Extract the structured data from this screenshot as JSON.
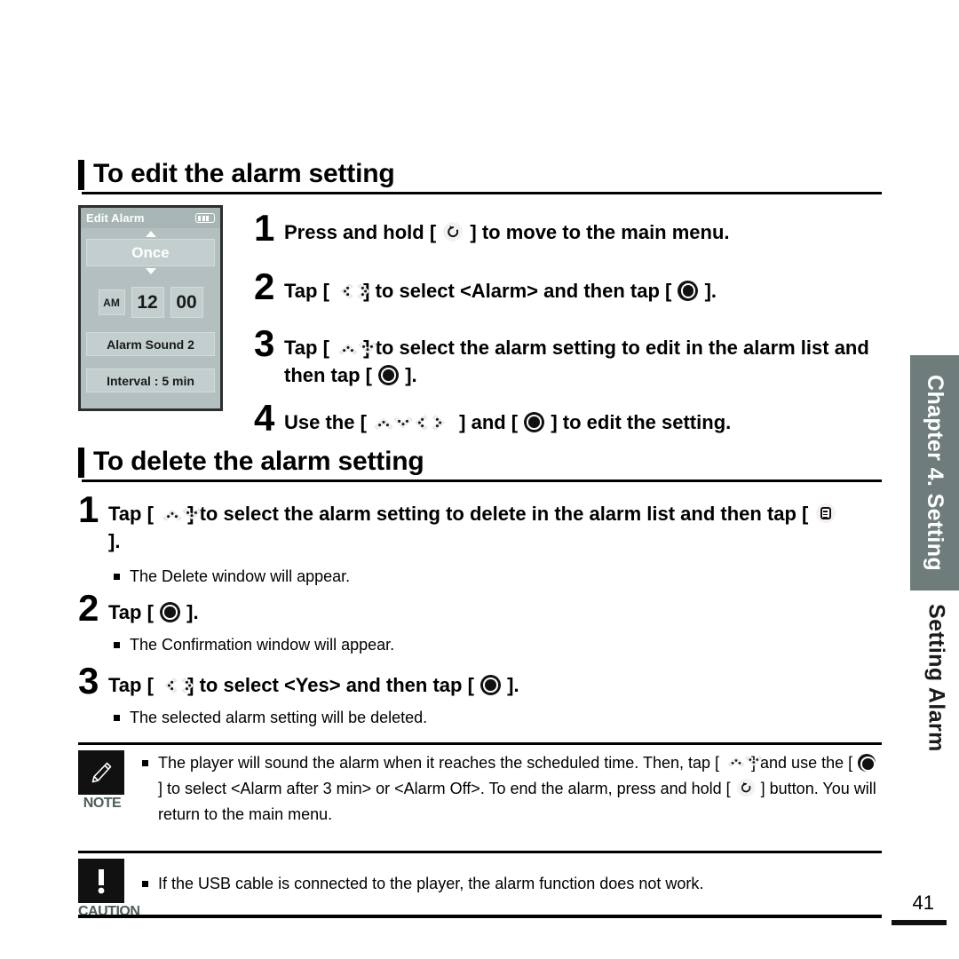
{
  "page": {
    "number": "41",
    "chapter_tab": "Chapter 4. Setting",
    "side_label": "Setting Alarm",
    "accent_tab_color": "#6e7d7c"
  },
  "device_screen": {
    "title": "Edit Alarm",
    "battery_icon": "battery-icon",
    "repeat": "Once",
    "ampm": "AM",
    "hour": "12",
    "minute": "00",
    "alarm_sound": "Alarm Sound 2",
    "interval": "Interval : 5 min",
    "bg_color": "#b4c0c0",
    "field_color": "#c3cece"
  },
  "section_edit": {
    "heading": "To edit the alarm setting",
    "steps": [
      {
        "num": "1",
        "parts": [
          {
            "t": "text",
            "v": "Press and hold [ "
          },
          {
            "t": "icon",
            "v": "back-icon"
          },
          {
            "t": "text",
            "v": " ] to move to the main menu."
          }
        ]
      },
      {
        "num": "2",
        "parts": [
          {
            "t": "text",
            "v": "Tap [ "
          },
          {
            "t": "icon",
            "v": "left-right-icon"
          },
          {
            "t": "text",
            "v": " ] to select <Alarm> and then tap [ "
          },
          {
            "t": "icon",
            "v": "select-icon"
          },
          {
            "t": "text",
            "v": " ]."
          }
        ]
      },
      {
        "num": "3",
        "parts": [
          {
            "t": "text",
            "v": "Tap [ "
          },
          {
            "t": "icon",
            "v": "up-down-icon"
          },
          {
            "t": "text",
            "v": " ] to select the alarm setting to edit in the alarm list and then tap [ "
          },
          {
            "t": "icon",
            "v": "select-icon"
          },
          {
            "t": "text",
            "v": " ]."
          }
        ]
      },
      {
        "num": "4",
        "parts": [
          {
            "t": "text",
            "v": "Use the [ "
          },
          {
            "t": "icon",
            "v": "up-down-left-right-icon"
          },
          {
            "t": "text",
            "v": " ] and [ "
          },
          {
            "t": "icon",
            "v": "select-icon"
          },
          {
            "t": "text",
            "v": " ] to edit the setting."
          }
        ]
      }
    ]
  },
  "section_delete": {
    "heading": "To delete the alarm setting",
    "step1": {
      "num": "1",
      "line1_a": "Tap [ ",
      "line1_b": " ] to select the alarm setting to delete in the alarm list and then tap [ ",
      "line1_c": " ].",
      "bullet": "The Delete window will appear."
    },
    "step2": {
      "num": "2",
      "a": "Tap [ ",
      "b": " ].",
      "bullet": "The Confirmation window will appear."
    },
    "step3": {
      "num": "3",
      "a": "Tap [ ",
      "b": " ] to select <Yes> and then tap [ ",
      "c": " ].",
      "bullet": "The selected alarm setting will be deleted."
    }
  },
  "note": {
    "label": "NOTE",
    "icon": "pencil-icon",
    "text_a": "The player will sound the alarm when it reaches the scheduled time. Then, tap [ ",
    "text_b": " ] and use the [ ",
    "text_c": " ] to select <Alarm after 3 min> or <Alarm Off>. To end the alarm, press and hold [ ",
    "text_d": " ] button. You will return to the main menu."
  },
  "caution": {
    "label": "CAUTION",
    "icon": "exclamation-icon",
    "text": "If the USB cable is connected to  the player, the alarm function does not work."
  }
}
